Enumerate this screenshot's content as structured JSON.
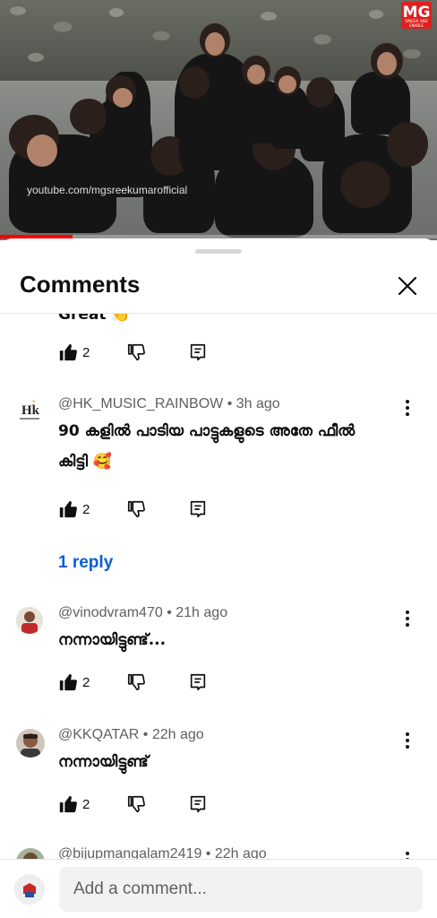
{
  "video": {
    "watermark": "youtube.com/mgsreekumarofficial",
    "logo_text": "MG",
    "logo_sub": "SINGER AND ENABLE",
    "progress": 0.165
  },
  "sheet": {
    "title": "Comments"
  },
  "comments": [
    {
      "partial_text": "Great 👏",
      "likes": "2"
    },
    {
      "author": "@HK_MUSIC_RAINBOW",
      "time": "3h ago",
      "text": "90 കളിൽ പാടിയ പാട്ടുകളുടെ അതേ ഫീൽ കിട്ടി 🥰",
      "likes": "2",
      "replies": "1 reply",
      "avatar_icon": "hk-music-logo-icon"
    },
    {
      "author": "@vinodvram470",
      "time": "21h ago",
      "text": "നന്നായിട്ടുണ്ട്...",
      "likes": "2",
      "avatar_icon": "person-avatar-icon"
    },
    {
      "author": "@KKQATAR",
      "time": "22h ago",
      "text": "നന്നായിട്ടുണ്ട്",
      "likes": "2",
      "avatar_icon": "person-avatar-icon"
    },
    {
      "author": "@bijupmangalam2419",
      "time": "22h ago",
      "avatar_icon": "person-avatar-icon"
    }
  ],
  "composer": {
    "placeholder": "Add a comment..."
  },
  "colors": {
    "link": "#065fd4",
    "progress": "#ff0000",
    "secondary_text": "#606060"
  }
}
